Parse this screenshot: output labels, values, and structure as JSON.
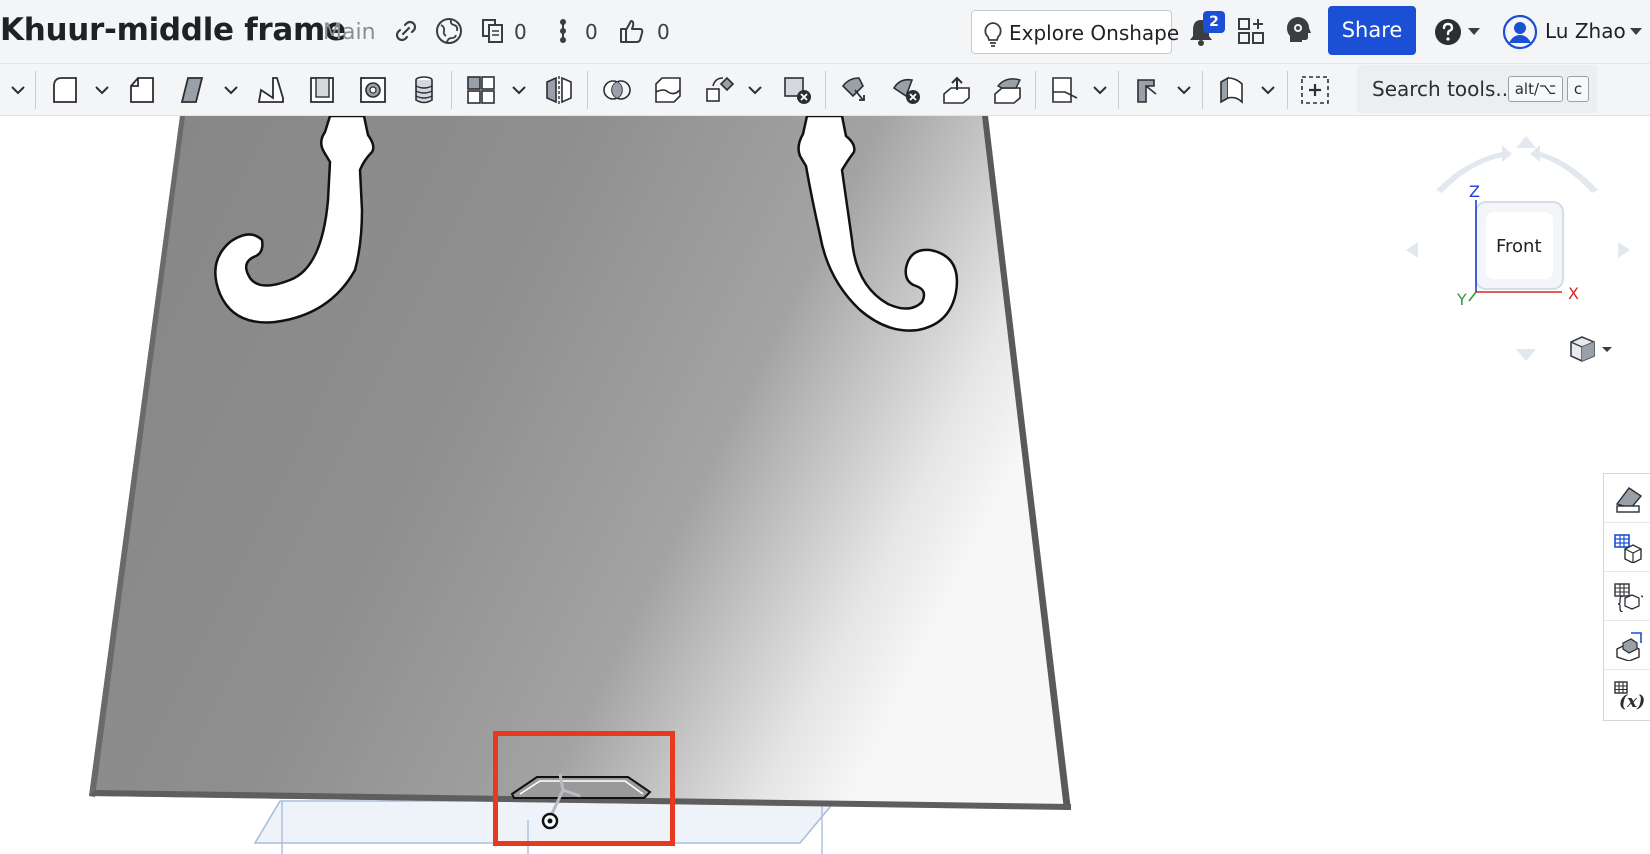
{
  "document": {
    "title": "Khuur-middle frame",
    "branch": "Main"
  },
  "header_stats": {
    "versions_count": "0",
    "branches_count": "0",
    "likes_count": "0"
  },
  "header_actions": {
    "explore_label": "Explore Onshape",
    "notifications_badge": "2",
    "share_label": "Share"
  },
  "user": {
    "name": "Lu Zhao"
  },
  "toolbar": {
    "search_label": "Search tools...",
    "shortcut_modifier": "alt/⌥",
    "shortcut_key": "c"
  },
  "view_cube": {
    "face_label": "Front",
    "axis_z": "Z",
    "axis_x": "X",
    "axis_y": "Y"
  },
  "colors": {
    "accent": "#1a4fd6",
    "highlight": "#e53a1f",
    "axis_x": "#d42a1e",
    "axis_y": "#2e9e3a",
    "axis_z": "#1a3fd6"
  },
  "icons": {
    "header": [
      "link-icon",
      "globe-icon",
      "versions-icon",
      "branches-icon",
      "thumbs-up-icon",
      "lightbulb-icon",
      "bell-icon",
      "app-store-icon",
      "learning-icon",
      "help-icon"
    ],
    "right_panel": [
      "appearance-icon",
      "bom-icon",
      "variables-icon",
      "assembly-view-icon",
      "custom-features-icon"
    ]
  }
}
